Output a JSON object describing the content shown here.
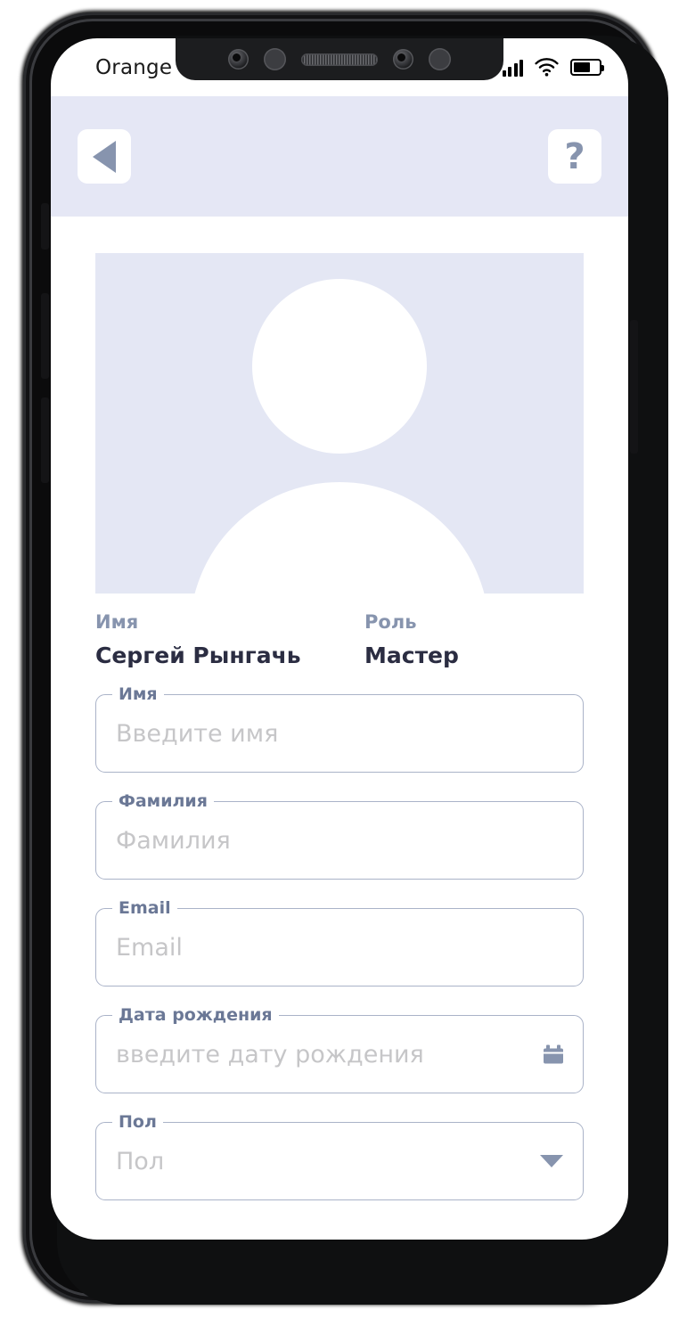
{
  "status_bar": {
    "carrier": "Orange",
    "signal_icon": "signal-bars-icon",
    "wifi_icon": "wifi-icon",
    "battery_icon": "battery-icon"
  },
  "header": {
    "back_icon": "back-triangle-icon",
    "help_label": "?"
  },
  "profile": {
    "avatar_icon": "user-avatar-placeholder",
    "name_label": "Имя",
    "name_value": "Сергей Рынгачь",
    "role_label": "Роль",
    "role_value": "Мастер"
  },
  "form": {
    "first_name": {
      "label": "Имя",
      "placeholder": "Введите имя",
      "value": ""
    },
    "last_name": {
      "label": "Фамилия",
      "placeholder": "Фамилия",
      "value": ""
    },
    "email": {
      "label": "Email",
      "placeholder": "Email",
      "value": ""
    },
    "birth_date": {
      "label": "Дата рождения",
      "placeholder": "введите дату рождения",
      "value": "",
      "icon": "calendar-icon"
    },
    "gender": {
      "label": "Пол",
      "placeholder": "Пол",
      "value": "",
      "icon": "chevron-down-icon"
    }
  },
  "colors": {
    "header_bg": "#e5e7f5",
    "avatar_bg": "#e4e7f4",
    "accent_muted": "#8794ae",
    "label_text": "#6b7896",
    "value_text": "#2b2d42",
    "field_border": "#aab3c8",
    "placeholder_text": "#c6c6c8"
  }
}
